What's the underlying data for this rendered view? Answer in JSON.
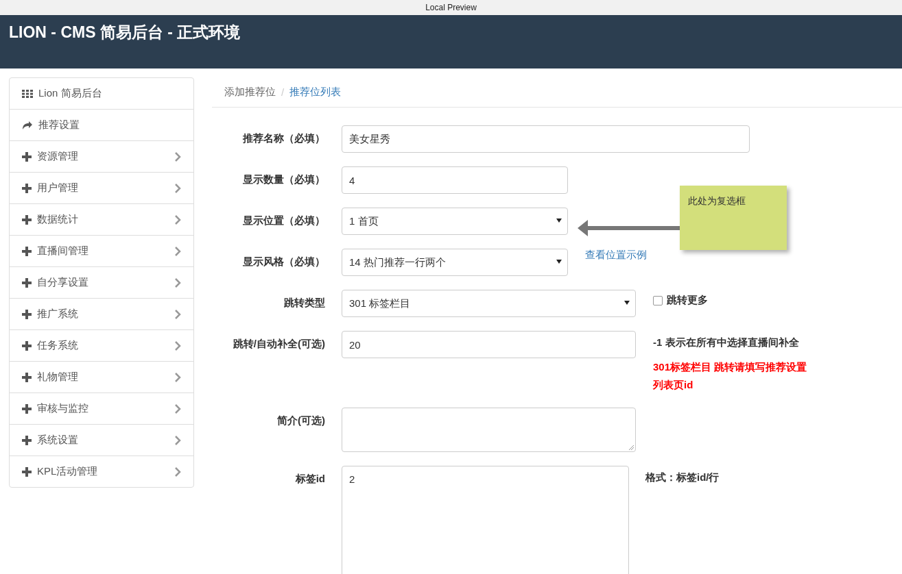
{
  "browser_bar": {
    "title": "Local Preview"
  },
  "header": {
    "title": "LION - CMS 简易后台 - 正式环境"
  },
  "sidebar": {
    "items": [
      {
        "label": "Lion 简易后台",
        "kind": "home",
        "expandable": false
      },
      {
        "label": "推荐设置",
        "kind": "shortcut",
        "expandable": false
      },
      {
        "label": "资源管理",
        "kind": "group",
        "expandable": true
      },
      {
        "label": "用户管理",
        "kind": "group",
        "expandable": true
      },
      {
        "label": "数据统计",
        "kind": "group",
        "expandable": true
      },
      {
        "label": "直播间管理",
        "kind": "group",
        "expandable": true
      },
      {
        "label": "自分享设置",
        "kind": "group",
        "expandable": true
      },
      {
        "label": "推广系统",
        "kind": "group",
        "expandable": true
      },
      {
        "label": "任务系统",
        "kind": "group",
        "expandable": true
      },
      {
        "label": "礼物管理",
        "kind": "group",
        "expandable": true
      },
      {
        "label": "审核与监控",
        "kind": "group",
        "expandable": true
      },
      {
        "label": "系统设置",
        "kind": "group",
        "expandable": true
      },
      {
        "label": "KPL活动管理",
        "kind": "group",
        "expandable": true
      }
    ]
  },
  "breadcrumb": {
    "separator": "/",
    "items": [
      {
        "label": "添加推荐位",
        "link": false
      },
      {
        "label": "推荐位列表",
        "link": true
      }
    ]
  },
  "form": {
    "fields": [
      {
        "kind": "input",
        "label": "推荐名称（必填）",
        "value": "美女星秀"
      },
      {
        "kind": "input",
        "label": "显示数量（必填）",
        "value": "4"
      },
      {
        "kind": "select",
        "label": "显示位置（必填）",
        "value": "1 首页"
      },
      {
        "kind": "select",
        "label": "显示风格（必填）",
        "value": "14 热门推荐一行两个",
        "aside": [
          {
            "kind": "link",
            "text": "查看位置示例"
          }
        ]
      },
      {
        "kind": "select",
        "label": "跳转类型",
        "value": "301 标签栏目",
        "aside": [
          {
            "kind": "checkbox",
            "text": "跳转更多",
            "checked": false
          }
        ]
      },
      {
        "kind": "input",
        "label": "跳转/自动补全(可选)",
        "value": "20",
        "aside": [
          {
            "kind": "note",
            "text": "-1 表示在所有中选择直播间补全"
          },
          {
            "kind": "warning",
            "text": "301标签栏目 跳转请填写推荐设置列表页id"
          }
        ]
      },
      {
        "kind": "textarea",
        "label": "简介(可选)"
      },
      {
        "kind": "textarea",
        "label": "标签id",
        "value": "2",
        "aside": [
          {
            "kind": "note",
            "text": "格式：标签id/行"
          }
        ]
      }
    ]
  },
  "sticky_note": {
    "text": "此处为复选框"
  }
}
